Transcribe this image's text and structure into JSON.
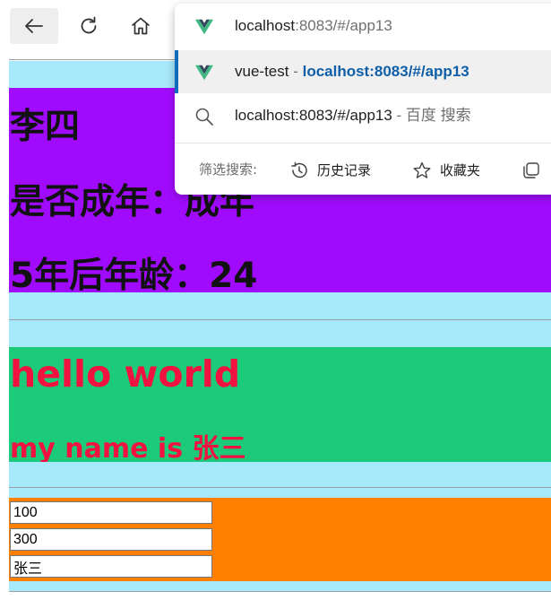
{
  "browser": {
    "toolbar": {
      "back_icon": "arrow-left-icon",
      "reload_icon": "reload-icon",
      "home_icon": "home-icon"
    },
    "omnibox_dropdown": {
      "suggestions": [
        {
          "icon": "vue-logo-icon",
          "url_host": "localhost",
          "url_rest": ":8083/#/app13"
        },
        {
          "icon": "vue-logo-icon",
          "title": "vue-test",
          "separator": " - ",
          "url": "localhost:8083/#/app13"
        },
        {
          "icon": "search-icon",
          "query": "localhost:8083/#/app13",
          "separator": " - ",
          "engine": "百度 搜索"
        }
      ],
      "filter": {
        "label": "筛选搜索:",
        "chips": [
          {
            "label": "历史记录",
            "icon": "history-icon"
          },
          {
            "label": "收藏夹",
            "icon": "star-icon"
          },
          {
            "label": "",
            "icon": "tabs-icon"
          }
        ]
      }
    }
  },
  "page": {
    "colors": {
      "cyan": "#a6e9fb",
      "purple": "#a10bfd",
      "green": "#1bcb7a",
      "orange": "#ff7f00",
      "red_text": "#f1123f"
    },
    "person": {
      "name": "李四",
      "adult_line": "是否成年：成年",
      "age_line": "5年后年龄：24"
    },
    "greeting": {
      "hello": "hello world",
      "my_name": "my name is 张三"
    },
    "inputs": {
      "first_value": "100",
      "second_value": "300",
      "name_value": "张三"
    }
  }
}
